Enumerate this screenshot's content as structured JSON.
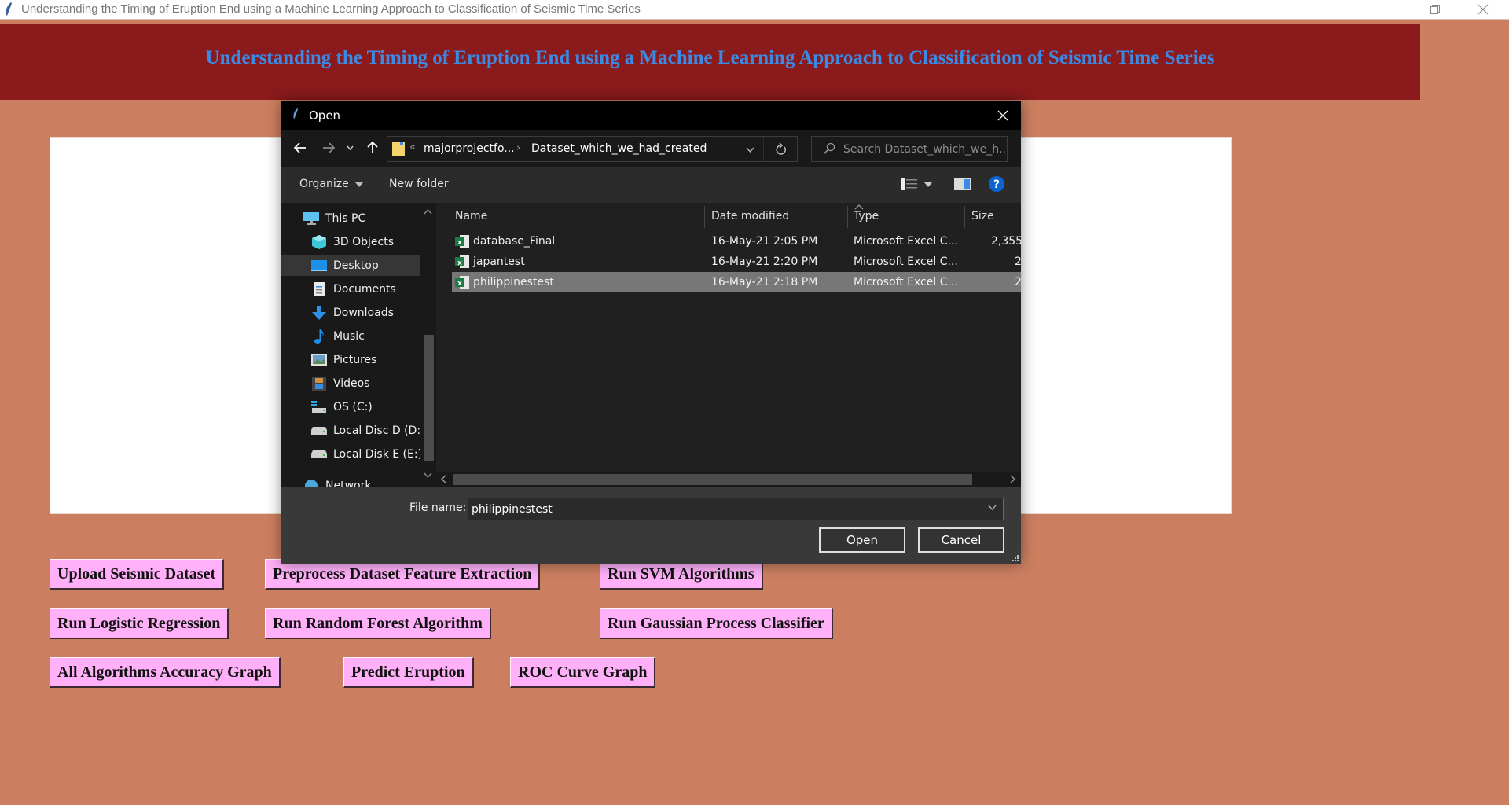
{
  "window": {
    "title": "Understanding the Timing of Eruption End using a Machine Learning Approach to Classification of Seismic Time Series",
    "controls": [
      "minimize",
      "restore",
      "close"
    ]
  },
  "banner": {
    "heading": "Understanding the Timing of Eruption End using a Machine Learning Approach to Classification of Seismic Time Series",
    "bg_color": "#8b1a1c",
    "text_color": "#3a8ae6"
  },
  "output_area": {
    "text": ""
  },
  "buttons": [
    {
      "id": "upload",
      "label": "Upload Seismic Dataset"
    },
    {
      "id": "preprocess",
      "label": "Preprocess Dataset Feature Extraction"
    },
    {
      "id": "svm",
      "label": "Run SVM Algorithms"
    },
    {
      "id": "logistic",
      "label": "Run Logistic Regression"
    },
    {
      "id": "random-forest",
      "label": "Run Random Forest Algorithm"
    },
    {
      "id": "gaussian",
      "label": "Run Gaussian Process Classifier"
    },
    {
      "id": "accuracy-graph",
      "label": "All Algorithms Accuracy Graph"
    },
    {
      "id": "predict",
      "label": "Predict Eruption"
    },
    {
      "id": "roc",
      "label": "ROC Curve Graph"
    }
  ],
  "dialog": {
    "title": "Open",
    "address": {
      "overflow": "«",
      "crumbs": [
        "majorprojectfo...",
        "Dataset_which_we_had_created"
      ]
    },
    "search_placeholder": "Search Dataset_which_we_h...",
    "toolbar": {
      "organize": "Organize",
      "new_folder": "New folder"
    },
    "nav": [
      {
        "label": "This PC",
        "icon": "this-pc-icon"
      },
      {
        "label": "3D Objects",
        "icon": "3d-objects-icon"
      },
      {
        "label": "Desktop",
        "icon": "desktop-icon",
        "selected": true
      },
      {
        "label": "Documents",
        "icon": "documents-icon"
      },
      {
        "label": "Downloads",
        "icon": "downloads-icon"
      },
      {
        "label": "Music",
        "icon": "music-icon"
      },
      {
        "label": "Pictures",
        "icon": "pictures-icon"
      },
      {
        "label": "Videos",
        "icon": "videos-icon"
      },
      {
        "label": "OS (C:)",
        "icon": "os-drive-icon"
      },
      {
        "label": "Local Disc D (D:)",
        "icon": "drive-icon"
      },
      {
        "label": "Local Disk E (E:)",
        "icon": "drive-icon"
      },
      {
        "label": "Network",
        "icon": "network-icon"
      }
    ],
    "columns": [
      "Name",
      "Date modified",
      "Type",
      "Size"
    ],
    "files": [
      {
        "name": "database_Final",
        "date": "16-May-21 2:05 PM",
        "type": "Microsoft Excel C...",
        "size": "2,355"
      },
      {
        "name": "japantest",
        "date": "16-May-21 2:20 PM",
        "type": "Microsoft Excel C...",
        "size": "2"
      },
      {
        "name": "philippinestest",
        "date": "16-May-21 2:18 PM",
        "type": "Microsoft Excel C...",
        "size": "2",
        "selected": true
      }
    ],
    "file_name_label": "File name:",
    "file_name_value": "philippinestest",
    "open_label": "Open",
    "cancel_label": "Cancel"
  }
}
